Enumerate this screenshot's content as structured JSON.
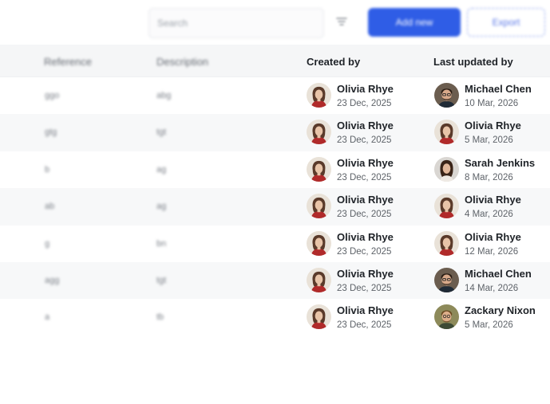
{
  "toolbar": {
    "search_placeholder": "Search",
    "filter_icon": "filter-icon",
    "primary_label": "Add new",
    "secondary_label": "Export"
  },
  "table": {
    "headers": {
      "col1": "Reference",
      "col2": "Description",
      "created_by": "Created by",
      "last_updated_by": "Last updated by"
    },
    "rows": [
      {
        "c1": "ggo",
        "c2": "abg",
        "created_name": "Olivia Rhye",
        "created_date": "23 Dec, 2025",
        "updated_name": "Michael Chen",
        "updated_date": "10 Mar, 2026"
      },
      {
        "c1": "gtg",
        "c2": "tgt",
        "created_name": "Olivia Rhye",
        "created_date": "23 Dec, 2025",
        "updated_name": "Olivia Rhye",
        "updated_date": "5 Mar, 2026"
      },
      {
        "c1": "b",
        "c2": "ag",
        "created_name": "Olivia Rhye",
        "created_date": "23 Dec, 2025",
        "updated_name": "Sarah Jenkins",
        "updated_date": "8 Mar, 2026"
      },
      {
        "c1": "ab",
        "c2": "ag",
        "created_name": "Olivia Rhye",
        "created_date": "23 Dec, 2025",
        "updated_name": "Olivia Rhye",
        "updated_date": "4 Mar, 2026"
      },
      {
        "c1": "g",
        "c2": "bn",
        "created_name": "Olivia Rhye",
        "created_date": "23 Dec, 2025",
        "updated_name": "Olivia Rhye",
        "updated_date": "12 Mar, 2026"
      },
      {
        "c1": "agg",
        "c2": "tgt",
        "created_name": "Olivia Rhye",
        "created_date": "23 Dec, 2025",
        "updated_name": "Michael Chen",
        "updated_date": "14 Mar, 2026"
      },
      {
        "c1": "a",
        "c2": "tb",
        "created_name": "Olivia Rhye",
        "created_date": "23 Dec, 2025",
        "updated_name": "Zackary Nixon",
        "updated_date": "5 Mar, 2026"
      }
    ]
  }
}
